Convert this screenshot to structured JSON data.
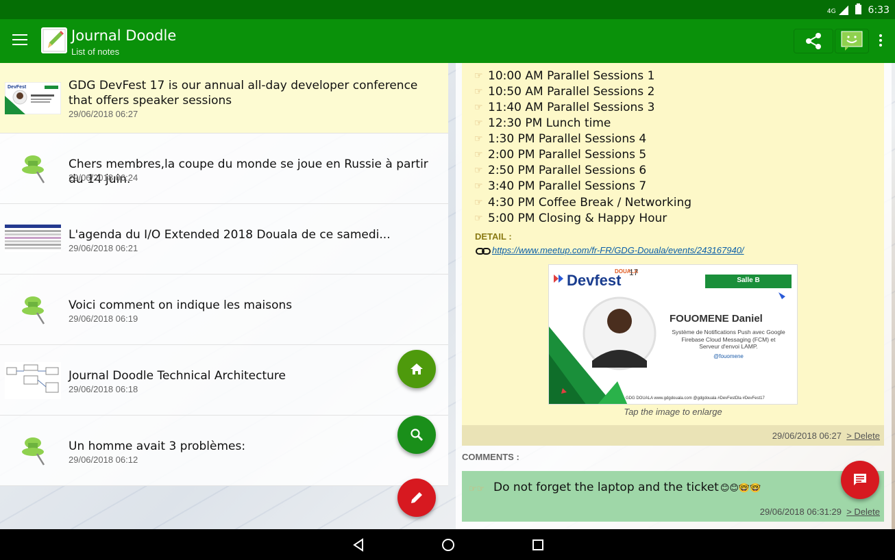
{
  "status_bar": {
    "network": "4G",
    "time": "6:33"
  },
  "app_bar": {
    "title": "Journal Doodle",
    "subtitle": "List of notes"
  },
  "notes": [
    {
      "title": "GDG DevFest 17 is our annual all-day developer conference that offers speaker sessions",
      "date": "29/06/2018 06:27",
      "thumb": "devfest-poster-thumb",
      "selected": true
    },
    {
      "title": "Chers membres,la coupe du monde se joue en Russie à partir du 14 juin.",
      "date": "29/06/2018 06:24",
      "thumb": "pushpin-icon"
    },
    {
      "title": "L'agenda du I/O Extended 2018 Douala de ce samedi...",
      "date": "29/06/2018 06:21",
      "thumb": "agenda-table-thumb"
    },
    {
      "title": "Voici comment on indique les maisons",
      "date": "29/06/2018 06:19",
      "thumb": "pushpin-icon"
    },
    {
      "title": "Journal Doodle Technical Architecture",
      "date": "29/06/2018 06:18",
      "thumb": "architecture-diagram-thumb"
    },
    {
      "title": "Un homme avait 3 problèmes:",
      "date": "29/06/2018 06:12",
      "thumb": "pushpin-icon"
    }
  ],
  "detail": {
    "schedule": [
      "10:00 AM Parallel Sessions 1",
      "10:50 AM Parallel Sessions 2",
      "11:40 AM Parallel Sessions 3",
      "12:30 PM Lunch time",
      "1:30 PM Parallel Sessions 4",
      "2:00 PM Parallel Sessions 5",
      "2:50 PM Parallel Sessions 6",
      "3:40 PM Parallel Sessions 7",
      "4:30 PM Coffee Break / Networking",
      "5:00 PM Closing & Happy Hour"
    ],
    "detail_label": "DETAIL :",
    "link": "https://www.meetup.com/fr-FR/GDG-Douala/events/243167940/",
    "poster": {
      "brand": "Devfest",
      "brand_city": "DOUALA",
      "brand_year": "17",
      "room": "Salle B",
      "speaker": "FOUOMENE Daniel",
      "talk": "Système de Notifications Push avec Google Firebase Cloud Messaging (FCM) et Serveur d'envoi LAMP.",
      "handle": "@fouomene",
      "footer": "GDG DOUALA   www.gdgdouala.com  @gdgdouala #DevFestDla #DevFest17"
    },
    "caption": "Tap the image to enlarge",
    "date": "29/06/2018 06:27",
    "delete_label": "> Delete",
    "comments_label": "COMMENTS :",
    "comment": {
      "text": "Do not forget the laptop and the ticket",
      "emojis": "😊😊🤓🤓",
      "date": "29/06/2018 06:31:29",
      "delete_label": "> Delete"
    }
  },
  "colors": {
    "primary": "#0a910a",
    "status": "#056e05",
    "selected": "#fdfbd2",
    "fab_home": "#4e9a0c",
    "fab_search": "#1a8f1a",
    "fab_edit": "#d71920"
  }
}
